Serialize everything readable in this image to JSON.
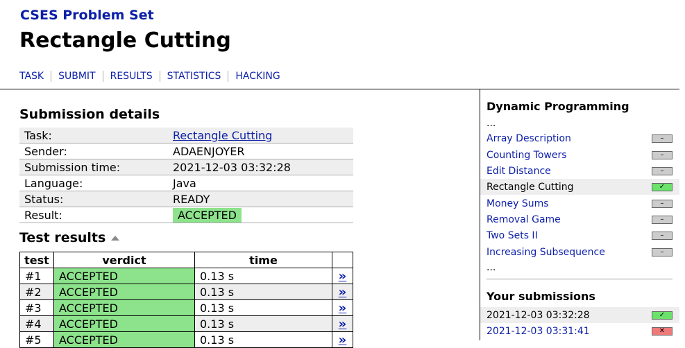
{
  "site_title": "CSES Problem Set",
  "page_title": "Rectangle Cutting",
  "nav": [
    "TASK",
    "SUBMIT",
    "RESULTS",
    "STATISTICS",
    "HACKING"
  ],
  "details": {
    "heading": "Submission details",
    "rows": [
      {
        "key": "Task:",
        "value": "Rectangle Cutting"
      },
      {
        "key": "Sender:",
        "value": "ADAENJOYER"
      },
      {
        "key": "Submission time:",
        "value": "2021-12-03 03:32:28"
      },
      {
        "key": "Language:",
        "value": "Java"
      },
      {
        "key": "Status:",
        "value": "READY"
      },
      {
        "key": "Result:",
        "value": "ACCEPTED"
      }
    ]
  },
  "tests": {
    "heading": "Test results",
    "columns": [
      "test",
      "verdict",
      "time"
    ],
    "rows": [
      {
        "test": "#1",
        "verdict": "ACCEPTED",
        "time": "0.13 s",
        "link": "»"
      },
      {
        "test": "#2",
        "verdict": "ACCEPTED",
        "time": "0.13 s",
        "link": "»"
      },
      {
        "test": "#3",
        "verdict": "ACCEPTED",
        "time": "0.13 s",
        "link": "»"
      },
      {
        "test": "#4",
        "verdict": "ACCEPTED",
        "time": "0.13 s",
        "link": "»"
      },
      {
        "test": "#5",
        "verdict": "ACCEPTED",
        "time": "0.13 s",
        "link": "»"
      }
    ]
  },
  "sidebar": {
    "heading": "Dynamic Programming",
    "ellipsis": "...",
    "tasks": [
      {
        "name": "Array Description",
        "status": "none"
      },
      {
        "name": "Counting Towers",
        "status": "none"
      },
      {
        "name": "Edit Distance",
        "status": "none"
      },
      {
        "name": "Rectangle Cutting",
        "status": "ok",
        "current": true
      },
      {
        "name": "Money Sums",
        "status": "none"
      },
      {
        "name": "Removal Game",
        "status": "none"
      },
      {
        "name": "Two Sets II",
        "status": "none"
      },
      {
        "name": "Increasing Subsequence",
        "status": "none"
      }
    ],
    "submissions_heading": "Your submissions",
    "submissions": [
      {
        "time": "2021-12-03 03:32:28",
        "status": "ok",
        "current": true
      },
      {
        "time": "2021-12-03 03:31:41",
        "status": "fail"
      }
    ]
  },
  "status_glyphs": {
    "none": "–",
    "ok": "✓",
    "fail": "✕"
  },
  "colors": {
    "link": "#0c1fa8",
    "accepted": "#8de38c",
    "ok_box": "#6be36b",
    "fail_box": "#f07a7a",
    "row_alt": "#eeeeee"
  }
}
